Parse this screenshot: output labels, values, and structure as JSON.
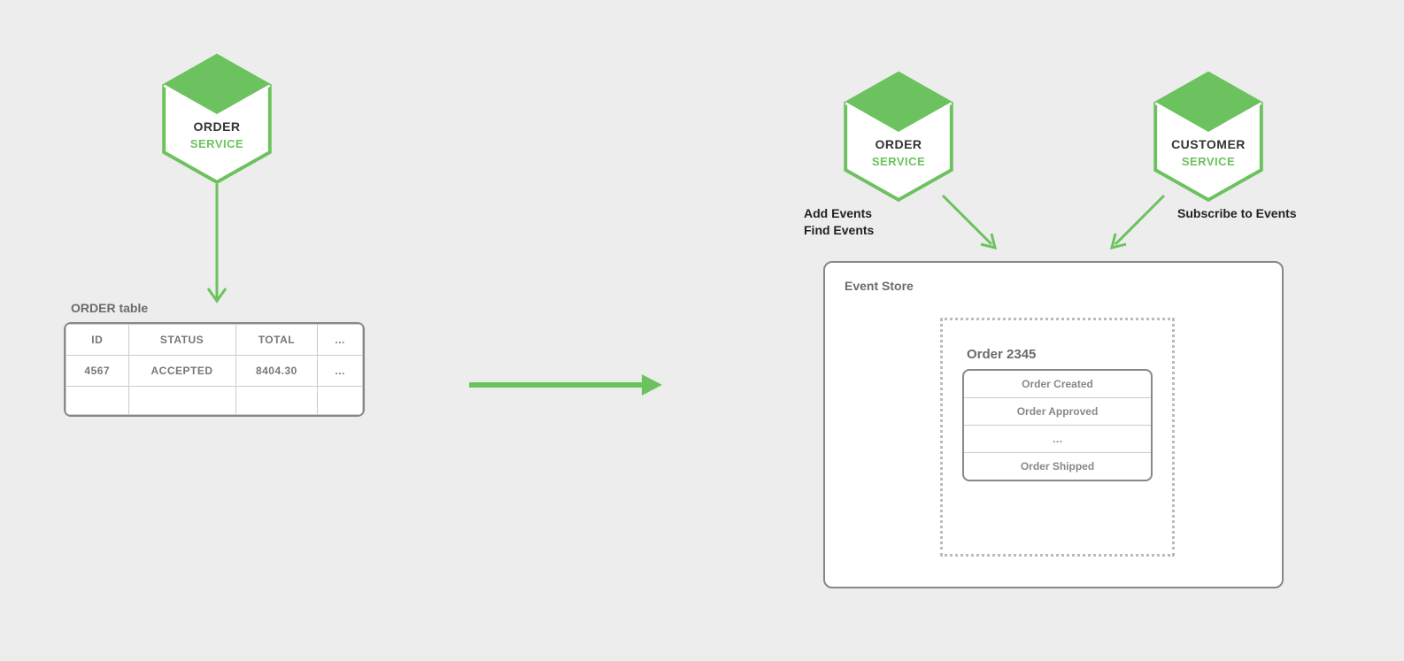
{
  "left": {
    "service": {
      "title": "ORDER",
      "subtitle": "SERVICE"
    },
    "table_title": "ORDER table",
    "table": {
      "headers": [
        "ID",
        "STATUS",
        "TOTAL",
        "…"
      ],
      "rows": [
        [
          "4567",
          "ACCEPTED",
          "8404.30",
          "…"
        ]
      ]
    }
  },
  "right": {
    "order_service": {
      "title": "ORDER",
      "subtitle": "SERVICE"
    },
    "customer_service": {
      "title": "CUSTOMER",
      "subtitle": "SERVICE"
    },
    "order_service_annot_line1": "Add Events",
    "order_service_annot_line2": "Find Events",
    "customer_service_annot": "Subscribe to Events",
    "event_store_title": "Event Store",
    "order_title": "Order 2345",
    "events": [
      "Order Created",
      "Order Approved",
      "…",
      "Order Shipped"
    ]
  },
  "colors": {
    "green": "#6cc25e"
  }
}
